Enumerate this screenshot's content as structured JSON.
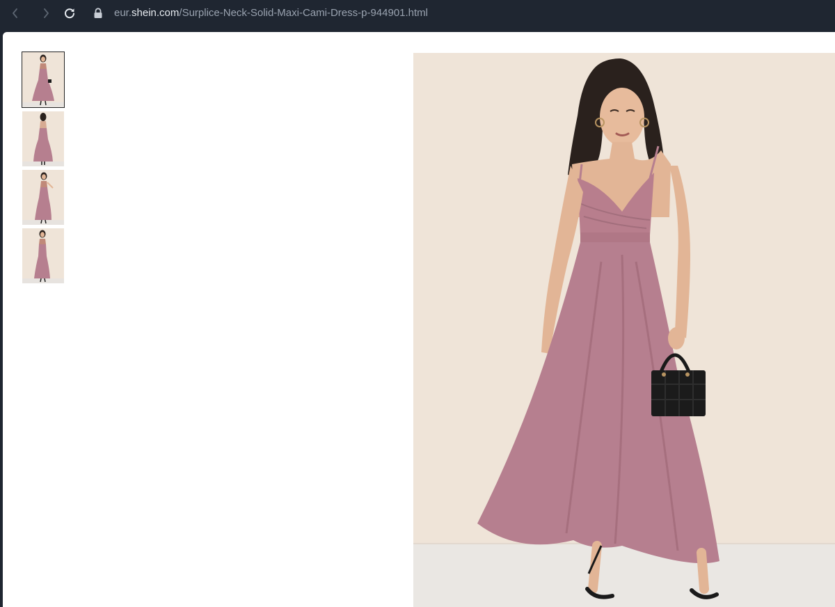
{
  "browser": {
    "url_prefix": "eur.",
    "url_domain": "shein.com",
    "url_path": "/Surplice-Neck-Solid-Maxi-Cami-Dress-p-944901.html",
    "icons": {
      "back": "chevron-left-icon",
      "forward": "chevron-right-icon",
      "reload": "reload-icon",
      "lock": "lock-icon"
    }
  },
  "gallery": {
    "thumbnails": [
      {
        "view": "front with handbag",
        "active": true
      },
      {
        "view": "back",
        "active": false
      },
      {
        "view": "side",
        "active": false
      },
      {
        "view": "front",
        "active": false
      }
    ],
    "main_image": {
      "subject": "model in mauve surplice neck maxi cami dress holding black handbag"
    }
  },
  "colors": {
    "chrome_bg": "#1f2631",
    "dress": "#b67f8f",
    "backdrop": "#efe4d8",
    "floor": "#eae7e3"
  }
}
